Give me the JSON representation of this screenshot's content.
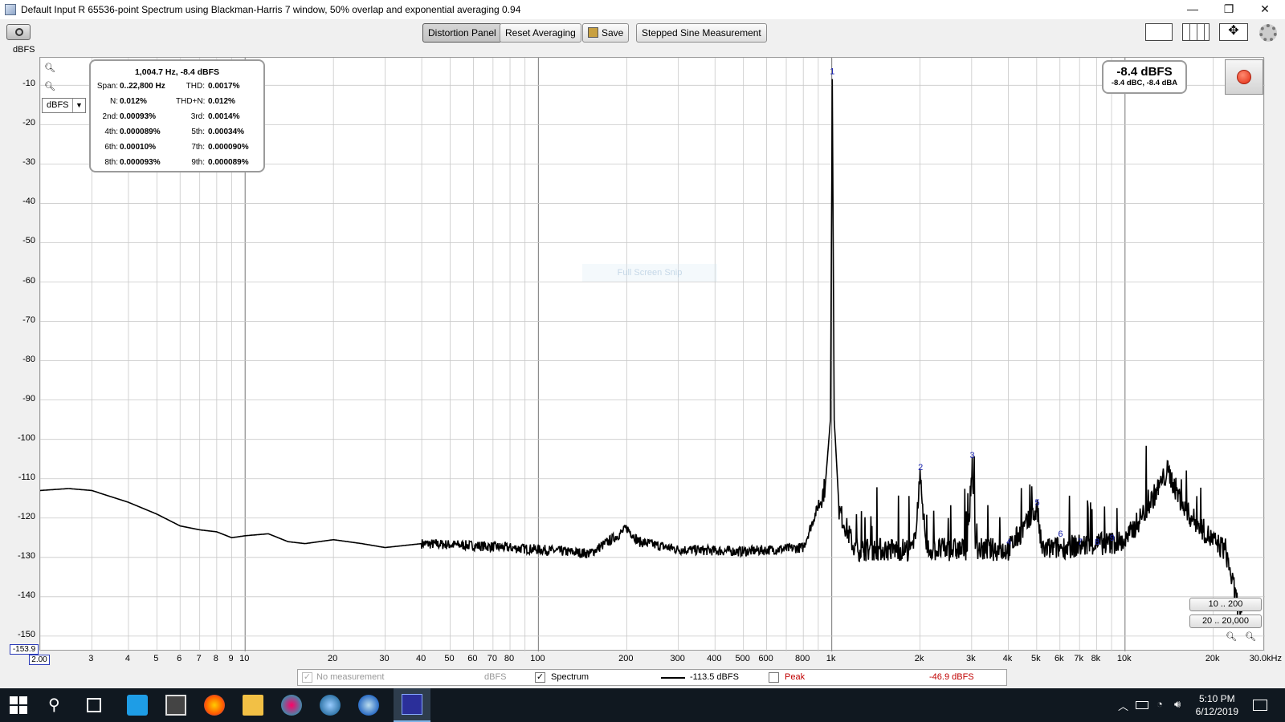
{
  "window": {
    "title": "Default Input R 65536-point Spectrum using Blackman-Harris 7 window, 50% overlap and exponential averaging 0.94",
    "controls": [
      "—",
      "❐",
      "✕"
    ]
  },
  "toolbar": {
    "y_unit_label": "dBFS",
    "distortion_panel_label": "Distortion Panel",
    "reset_averaging_label": "Reset Averaging",
    "save_label": "Save",
    "stepped_sine_label": "Stepped Sine Measurement"
  },
  "unit_select": {
    "value": "dBFS"
  },
  "distortion": {
    "header": "1,004.7 Hz, -8.4 dBFS",
    "rows": [
      {
        "l1": "Span:",
        "v1": "0..22,800 Hz",
        "l2": "THD:",
        "v2": "0.0017%"
      },
      {
        "l1": "N:",
        "v1": "0.012%",
        "l2": "THD+N:",
        "v2": "0.012%"
      },
      {
        "l1": "2nd:",
        "v1": "0.00093%",
        "l2": "3rd:",
        "v2": "0.0014%"
      },
      {
        "l1": "4th:",
        "v1": "0.000089%",
        "l2": "5th:",
        "v2": "0.00034%"
      },
      {
        "l1": "6th:",
        "v1": "0.00010%",
        "l2": "7th:",
        "v2": "0.000090%"
      },
      {
        "l1": "8th:",
        "v1": "0.000093%",
        "l2": "9th:",
        "v2": "0.000089%"
      }
    ]
  },
  "level": {
    "main": "-8.4 dBFS",
    "sub": "-8.4 dBC, -8.4 dBA"
  },
  "watermark": "Full Screen Snip",
  "zoom_presets": [
    "10 .. 200",
    "20 .. 20,000"
  ],
  "axis_readouts": {
    "y_min": "-153.9",
    "x_min": "2.00"
  },
  "legend": {
    "no_measurement": "No measurement",
    "no_measurement_unit": "dBFS",
    "spectrum_label": "Spectrum",
    "spectrum_value": "-113.5 dBFS",
    "peak_label": "Peak",
    "peak_value": "-46.9 dBFS"
  },
  "taskbar": {
    "time": "5:10 PM",
    "date": "6/12/2019"
  },
  "chart_data": {
    "type": "line",
    "ylabel": "dBFS",
    "xscale": "log",
    "ylim": [
      -153.9,
      -3
    ],
    "xlim": [
      2,
      30000
    ],
    "y_ticks": [
      "-10",
      "-20",
      "-30",
      "-40",
      "-50",
      "-60",
      "-70",
      "-80",
      "-90",
      "-100",
      "-110",
      "-120",
      "-130",
      "-140",
      "-150"
    ],
    "x_ticks": [
      {
        "v": 3,
        "t": "3"
      },
      {
        "v": 4,
        "t": "4"
      },
      {
        "v": 5,
        "t": "5"
      },
      {
        "v": 6,
        "t": "6"
      },
      {
        "v": 7,
        "t": "7"
      },
      {
        "v": 8,
        "t": "8"
      },
      {
        "v": 9,
        "t": "9"
      },
      {
        "v": 10,
        "t": "10"
      },
      {
        "v": 20,
        "t": "20"
      },
      {
        "v": 30,
        "t": "30"
      },
      {
        "v": 40,
        "t": "40"
      },
      {
        "v": 50,
        "t": "50"
      },
      {
        "v": 60,
        "t": "60"
      },
      {
        "v": 70,
        "t": "70"
      },
      {
        "v": 80,
        "t": "80"
      },
      {
        "v": 100,
        "t": "100"
      },
      {
        "v": 200,
        "t": "200"
      },
      {
        "v": 300,
        "t": "300"
      },
      {
        "v": 400,
        "t": "400"
      },
      {
        "v": 500,
        "t": "500"
      },
      {
        "v": 600,
        "t": "600"
      },
      {
        "v": 800,
        "t": "800"
      },
      {
        "v": 1000,
        "t": "1k"
      },
      {
        "v": 2000,
        "t": "2k"
      },
      {
        "v": 3000,
        "t": "3k"
      },
      {
        "v": 4000,
        "t": "4k"
      },
      {
        "v": 5000,
        "t": "5k"
      },
      {
        "v": 6000,
        "t": "6k"
      },
      {
        "v": 7000,
        "t": "7k"
      },
      {
        "v": 8000,
        "t": "8k"
      },
      {
        "v": 10000,
        "t": "10k"
      },
      {
        "v": 20000,
        "t": "20k"
      },
      {
        "v": 30000,
        "t": "30.0kHz"
      }
    ],
    "series": [
      {
        "name": "Spectrum",
        "points": [
          [
            2,
            -113
          ],
          [
            2.5,
            -112.5
          ],
          [
            3,
            -113
          ],
          [
            4,
            -116
          ],
          [
            5,
            -119
          ],
          [
            6,
            -122
          ],
          [
            7,
            -123
          ],
          [
            8,
            -123.5
          ],
          [
            9,
            -125
          ],
          [
            10,
            -124.5
          ],
          [
            12,
            -124
          ],
          [
            14,
            -126
          ],
          [
            16,
            -126.5
          ],
          [
            20,
            -125.5
          ],
          [
            25,
            -126.5
          ],
          [
            30,
            -127.5
          ],
          [
            40,
            -126.5
          ],
          [
            60,
            -127
          ],
          [
            100,
            -128
          ],
          [
            150,
            -129
          ],
          [
            190,
            -124
          ],
          [
            200,
            -122.5
          ],
          [
            220,
            -126
          ],
          [
            300,
            -128
          ],
          [
            500,
            -128.5
          ],
          [
            800,
            -127.5
          ],
          [
            950,
            -112
          ],
          [
            990,
            -95
          ],
          [
            1004.7,
            -8.4
          ],
          [
            1020,
            -95
          ],
          [
            1060,
            -118
          ],
          [
            1200,
            -128
          ],
          [
            1900,
            -128
          ],
          [
            2009,
            -109
          ],
          [
            2100,
            -128
          ],
          [
            2900,
            -128
          ],
          [
            3014,
            -106
          ],
          [
            3100,
            -128
          ],
          [
            4000,
            -128
          ],
          [
            5024,
            -118
          ],
          [
            5200,
            -128
          ],
          [
            7000,
            -127
          ],
          [
            10000,
            -126
          ],
          [
            12000,
            -117
          ],
          [
            14000,
            -108
          ],
          [
            16000,
            -118
          ],
          [
            19000,
            -124
          ],
          [
            20000,
            -126
          ],
          [
            22000,
            -128
          ],
          [
            24000,
            -141
          ],
          [
            25000,
            -144
          ]
        ]
      }
    ],
    "harmonic_markers": [
      {
        "n": "1",
        "x": 1004.7,
        "y": -8.4
      },
      {
        "n": "2",
        "x": 2009,
        "y": -109
      },
      {
        "n": "3",
        "x": 3014,
        "y": -106
      },
      {
        "n": "4",
        "x": 4019,
        "y": -128
      },
      {
        "n": "5",
        "x": 5024,
        "y": -118
      },
      {
        "n": "6",
        "x": 6028,
        "y": -126
      },
      {
        "n": "7",
        "x": 7033,
        "y": -128
      },
      {
        "n": "8",
        "x": 8038,
        "y": -128
      },
      {
        "n": "9",
        "x": 9042,
        "y": -127
      }
    ],
    "colors": {
      "trace": "#000000",
      "grid": "#c8c8c8",
      "grid_major": "#8c8c8c",
      "marker": "#1a23b0"
    }
  }
}
